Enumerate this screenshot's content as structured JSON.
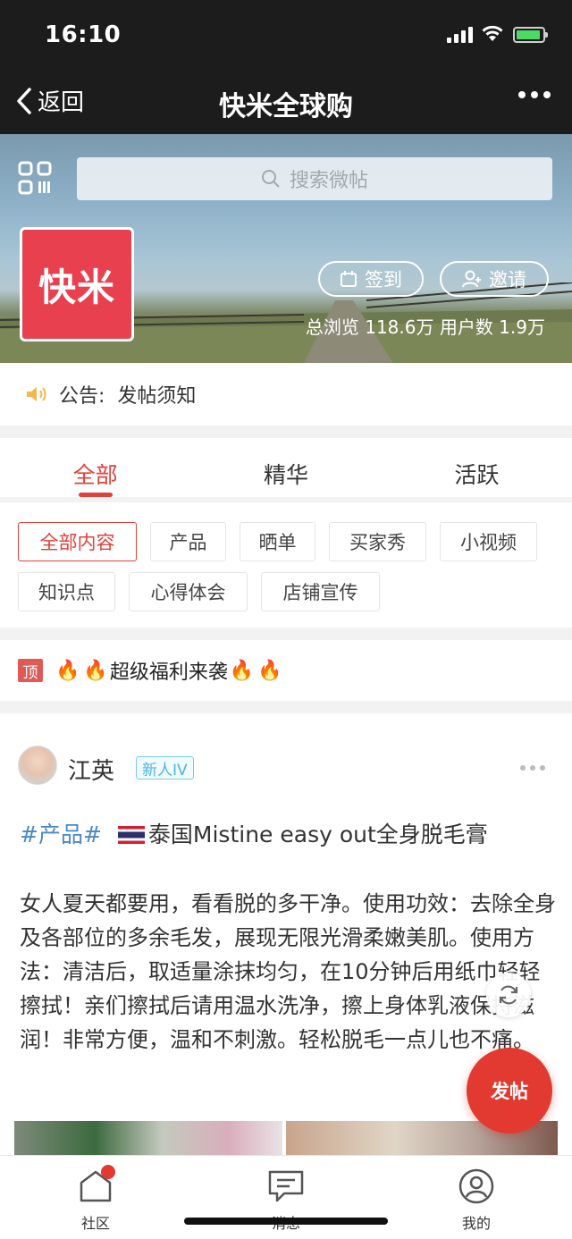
{
  "status_bar": {
    "time": "16:10"
  },
  "nav": {
    "back_label": "返回",
    "title": "快米全球购"
  },
  "banner": {
    "search_placeholder": "搜索微帖",
    "logo_text": "快米",
    "checkin_label": "签到",
    "invite_label": "邀请",
    "stats": "总浏览 118.6万  用户数 1.9万"
  },
  "notice": {
    "label": "公告:",
    "text": "发帖须知"
  },
  "tabs": [
    {
      "label": "全部",
      "active": true
    },
    {
      "label": "精华",
      "active": false
    },
    {
      "label": "活跃",
      "active": false
    }
  ],
  "filters": [
    {
      "label": "全部内容",
      "active": true
    },
    {
      "label": "产品"
    },
    {
      "label": "晒单"
    },
    {
      "label": "买家秀"
    },
    {
      "label": "小视频"
    },
    {
      "label": "知识点"
    },
    {
      "label": "心得体会"
    },
    {
      "label": "店铺宣传"
    }
  ],
  "pinned": {
    "badge": "顶",
    "title": "超级福利来袭"
  },
  "post": {
    "author": "江英",
    "level": "新人IV",
    "tag": "#产品#",
    "title": "泰国Mistine easy out全身脱毛膏",
    "body": "女人夏天都要用，看看脱的多干净。使用功效：去除全身及各部位的多余毛发，展现无限光滑柔嫩美肌。使用方法：清洁后，取适量涂抹均匀，在10分钟后用纸巾轻轻擦拭！亲们擦拭后请用温水洗净，擦上身体乳液保持滋润！非常方便，温和不刺激。轻松脱毛一点儿也不痛。"
  },
  "fab": {
    "post_label": "发帖"
  },
  "bottom_nav": [
    {
      "label": "社区"
    },
    {
      "label": "消息"
    },
    {
      "label": "我的"
    }
  ],
  "colors": {
    "accent": "#e0413b",
    "tag_blue": "#4a88c7",
    "logo_red": "#e8404f"
  }
}
